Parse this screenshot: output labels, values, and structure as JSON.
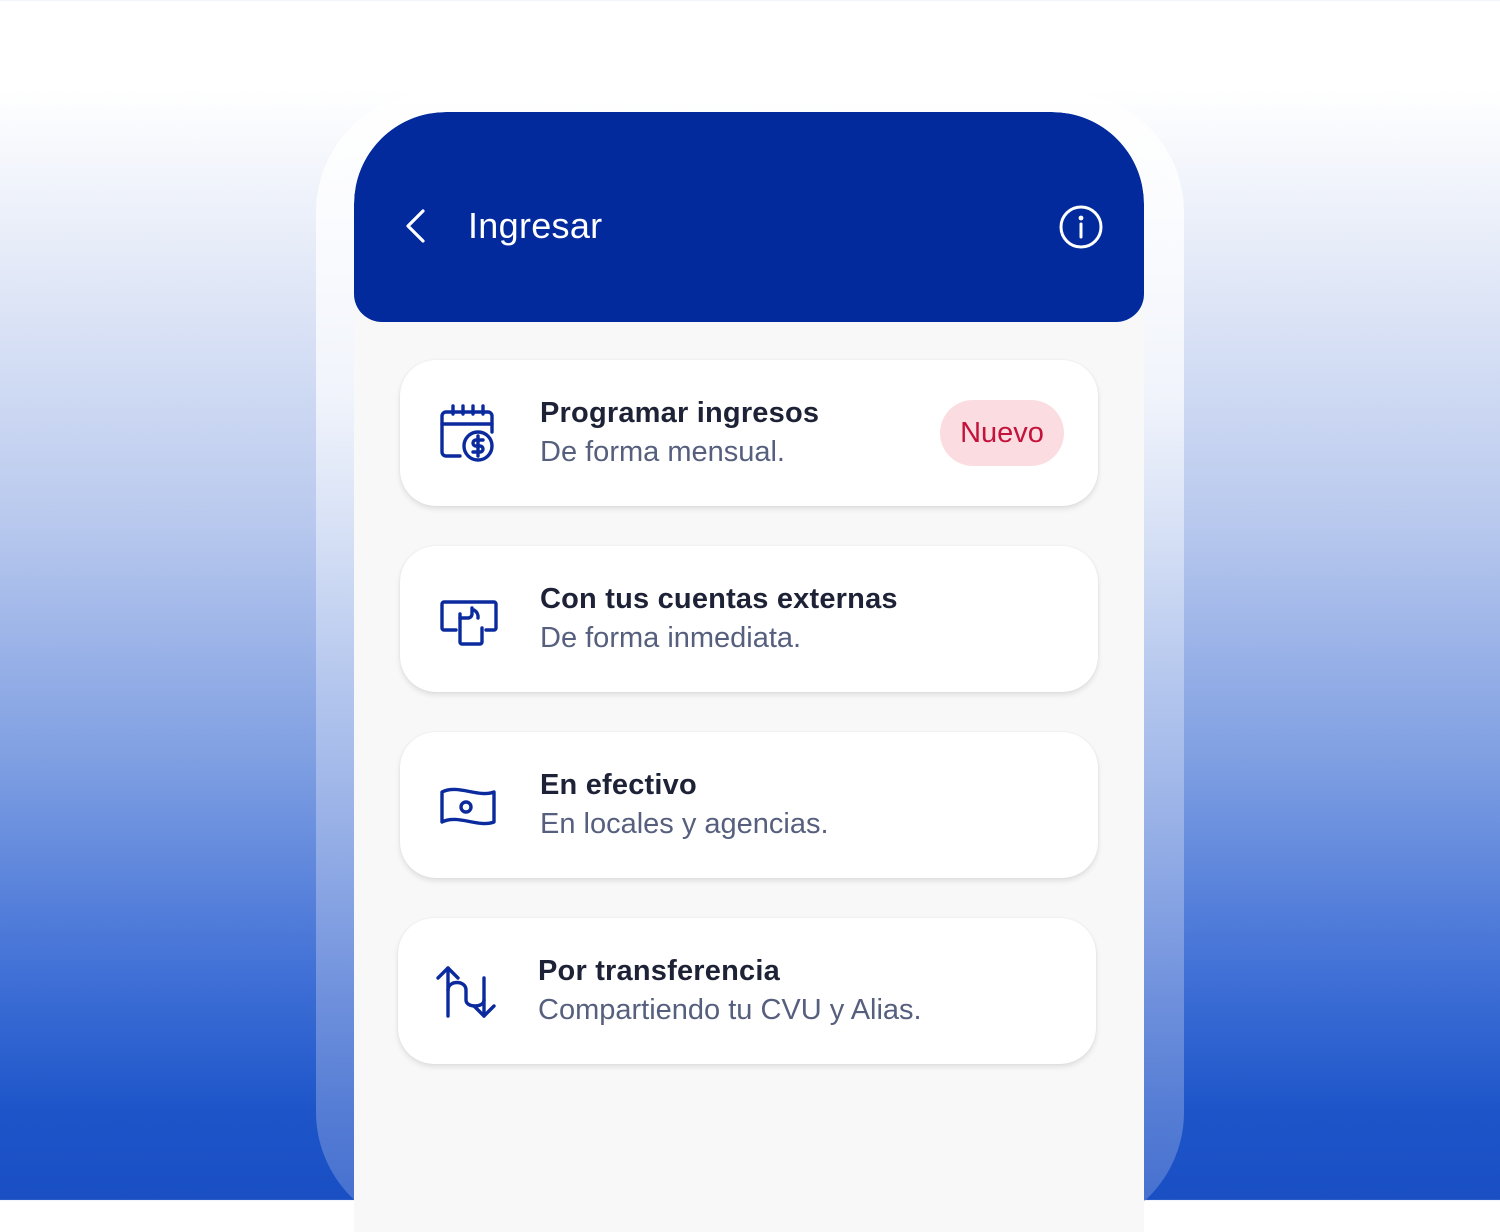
{
  "header": {
    "title": "Ingresar",
    "back_icon": "chevron-left-icon",
    "info_icon": "info-icon"
  },
  "colors": {
    "header_bg": "#022a9c",
    "icon": "#0a2a9e",
    "badge_bg": "#fbdde1",
    "badge_text": "#c4123a"
  },
  "options": [
    {
      "title": "Programar ingresos",
      "subtitle": "De forma mensual.",
      "icon": "calendar-dollar-icon",
      "badge": "Nuevo"
    },
    {
      "title": "Con tus cuentas externas",
      "subtitle": "De forma inmediata.",
      "icon": "external-account-icon"
    },
    {
      "title": "En efectivo",
      "subtitle": "En locales y agencias.",
      "icon": "banknote-icon"
    },
    {
      "title": "Por transferencia",
      "subtitle": "Compartiendo tu CVU y Alias.",
      "icon": "transfer-arrows-icon"
    }
  ]
}
